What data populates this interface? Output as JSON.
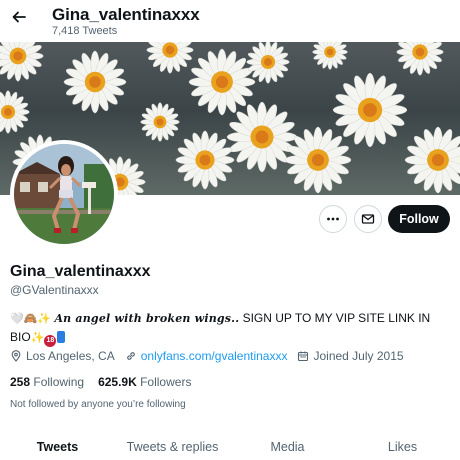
{
  "header": {
    "title": "Gina_valentinaxxx",
    "tweet_count": "7,418 Tweets",
    "back_icon": "arrow-left-icon"
  },
  "profile": {
    "display_name": "Gina_valentinaxxx",
    "handle": "@GValentinaxxx",
    "bio": {
      "prefix_emoji": "🤍🙈✨",
      "script_text": "An angel with broken wings..",
      "main_text": " SIGN UP TO MY VIP SITE LINK IN BIO",
      "suffix_sparkle": "✨",
      "badge_18": "18"
    },
    "location": "Los Angeles, CA",
    "website": "onlyfans.com/gvalentinaxxx",
    "joined": "Joined July 2015",
    "following_count": "258",
    "following_label": " Following",
    "followers_count": "625.9K",
    "followers_label": " Followers",
    "not_followed_note": "Not followed by anyone you’re following"
  },
  "actions": {
    "more_icon": "more-icon",
    "message_icon": "mail-icon",
    "follow_label": "Follow"
  },
  "tabs": [
    {
      "label": "Tweets",
      "active": true
    },
    {
      "label": "Tweets & replies",
      "active": false
    },
    {
      "label": "Media",
      "active": false
    },
    {
      "label": "Likes",
      "active": false
    }
  ],
  "colors": {
    "text": "#0f1419",
    "secondary": "#536471",
    "link": "#1d9bf0",
    "follow_button": "#0f1419"
  }
}
